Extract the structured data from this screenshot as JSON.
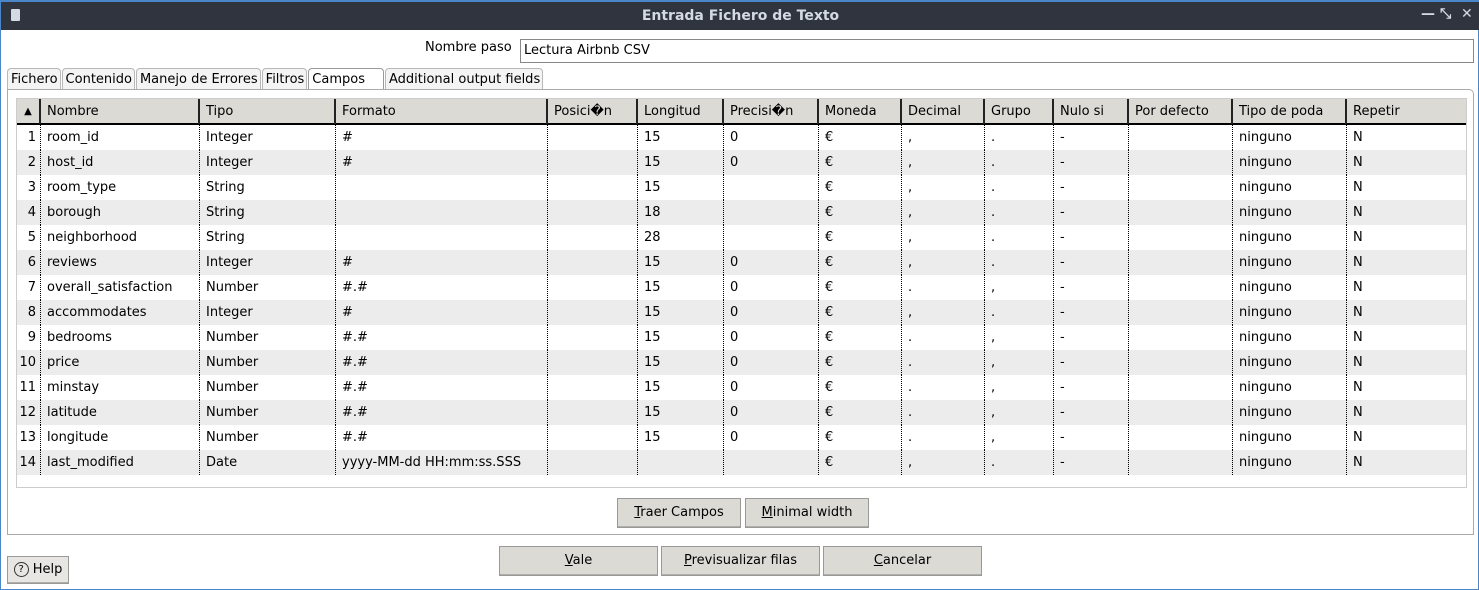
{
  "window": {
    "title": "Entrada Fichero de Texto",
    "icons": [
      "document-icon",
      "minimize-icon",
      "restore-icon",
      "close-icon"
    ]
  },
  "step": {
    "label": "Nombre paso",
    "value": "Lectura Airbnb CSV"
  },
  "tabs": [
    "Fichero",
    "Contenido",
    "Manejo de Errores",
    "Filtros",
    "Campos",
    "Additional output fields"
  ],
  "active_tab": "Campos",
  "table": {
    "sort_indicator": "▲",
    "columns": [
      "Nombre",
      "Tipo",
      "Formato",
      "Posici�n",
      "Longitud",
      "Precisi�n",
      "Moneda",
      "Decimal",
      "Grupo",
      "Nulo si",
      "Por defecto",
      "Tipo de poda",
      "Repetir"
    ],
    "rows": [
      [
        "1",
        "room_id",
        "Integer",
        "#",
        "",
        "15",
        "0",
        "€",
        ",",
        ".",
        "-",
        "",
        "ninguno",
        "N"
      ],
      [
        "2",
        "host_id",
        "Integer",
        "#",
        "",
        "15",
        "0",
        "€",
        ",",
        ".",
        "-",
        "",
        "ninguno",
        "N"
      ],
      [
        "3",
        "room_type",
        "String",
        "",
        "",
        "15",
        "",
        "€",
        ",",
        ".",
        "-",
        "",
        "ninguno",
        "N"
      ],
      [
        "4",
        "borough",
        "String",
        "",
        "",
        "18",
        "",
        "€",
        ",",
        ".",
        "-",
        "",
        "ninguno",
        "N"
      ],
      [
        "5",
        "neighborhood",
        "String",
        "",
        "",
        "28",
        "",
        "€",
        ",",
        ".",
        "-",
        "",
        "ninguno",
        "N"
      ],
      [
        "6",
        "reviews",
        "Integer",
        "#",
        "",
        "15",
        "0",
        "€",
        ",",
        ".",
        "-",
        "",
        "ninguno",
        "N"
      ],
      [
        "7",
        "overall_satisfaction",
        "Number",
        "#.#",
        "",
        "15",
        "0",
        "€",
        ".",
        ",",
        "-",
        "",
        "ninguno",
        "N"
      ],
      [
        "8",
        "accommodates",
        "Integer",
        "#",
        "",
        "15",
        "0",
        "€",
        ",",
        ".",
        "-",
        "",
        "ninguno",
        "N"
      ],
      [
        "9",
        "bedrooms",
        "Number",
        "#.#",
        "",
        "15",
        "0",
        "€",
        ".",
        ",",
        "-",
        "",
        "ninguno",
        "N"
      ],
      [
        "10",
        "price",
        "Number",
        "#.#",
        "",
        "15",
        "0",
        "€",
        ".",
        ",",
        "-",
        "",
        "ninguno",
        "N"
      ],
      [
        "11",
        "minstay",
        "Number",
        "#.#",
        "",
        "15",
        "0",
        "€",
        ".",
        ",",
        "-",
        "",
        "ninguno",
        "N"
      ],
      [
        "12",
        "latitude",
        "Number",
        "#.#",
        "",
        "15",
        "0",
        "€",
        ".",
        ",",
        "-",
        "",
        "ninguno",
        "N"
      ],
      [
        "13",
        "longitude",
        "Number",
        "#.#",
        "",
        "15",
        "0",
        "€",
        ".",
        ",",
        "-",
        "",
        "ninguno",
        "N"
      ],
      [
        "14",
        "last_modified",
        "Date",
        "yyyy-MM-dd HH:mm:ss.SSS",
        "",
        "",
        "",
        "€",
        ",",
        ".",
        "-",
        "",
        "ninguno",
        "N"
      ]
    ]
  },
  "buttons": {
    "get_fields": {
      "mnemonic": "T",
      "rest": "raer Campos"
    },
    "minimal_width": {
      "mnemonic": "M",
      "rest": "inimal width"
    },
    "ok": {
      "mnemonic": "V",
      "rest": "ale"
    },
    "preview": {
      "mnemonic": "P",
      "rest": "revisualizar filas"
    },
    "cancel": {
      "mnemonic": "C",
      "rest": "ancelar"
    },
    "help": "Help"
  }
}
